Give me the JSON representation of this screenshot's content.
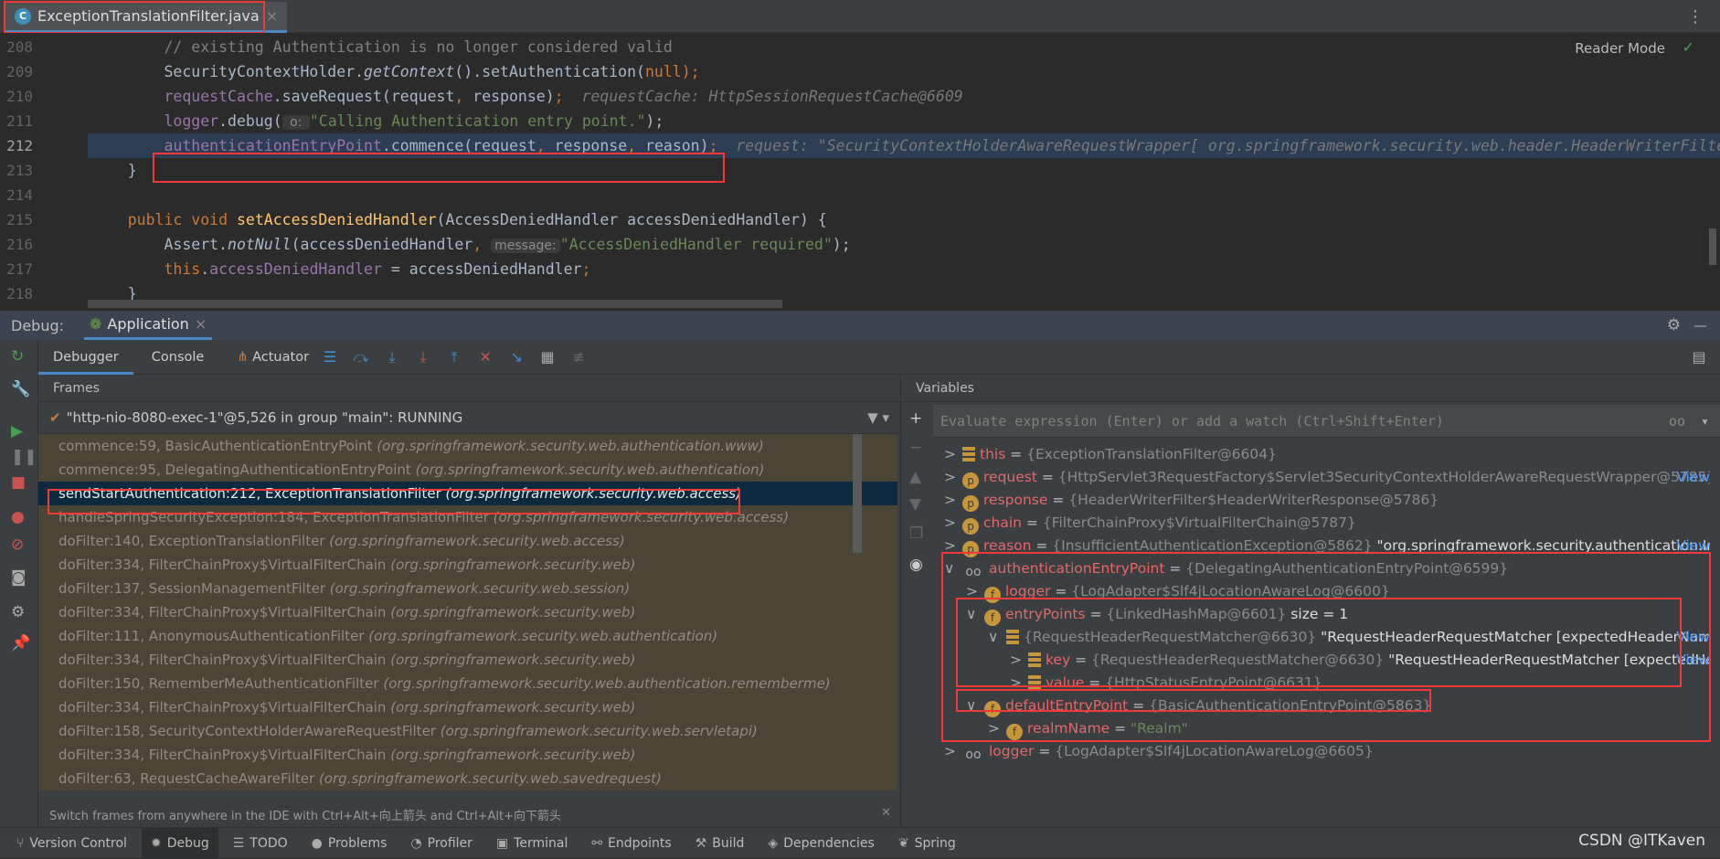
{
  "tab": {
    "file": "ExceptionTranslationFilter.java",
    "close": "×",
    "icon": "java-class-icon"
  },
  "editor": {
    "reader_mode": "Reader Mode",
    "current_line": "212",
    "lines": [
      {
        "n": "208",
        "t": [
          [
            "        // existing Authentication is no longer considered valid",
            "cm"
          ]
        ]
      },
      {
        "n": "209",
        "t": [
          [
            "        SecurityContextHolder.",
            ""
          ],
          [
            "getContext",
            "it"
          ],
          [
            "().setAuthentication(",
            ""
          ],
          [
            "null",
            "kw"
          ],
          [
            ");",
            "kw"
          ]
        ]
      },
      {
        "n": "210",
        "t": [
          [
            "        ",
            ""
          ],
          [
            "requestCache",
            "fld"
          ],
          [
            ".saveRequest(request",
            ""
          ],
          [
            ",",
            "kw"
          ],
          [
            " response)",
            ""
          ],
          [
            ";",
            "kw"
          ],
          [
            "  requestCache: HttpSessionRequestCache@6609",
            "hint"
          ]
        ]
      },
      {
        "n": "211",
        "t": [
          [
            "        ",
            ""
          ],
          [
            "logger",
            "fld"
          ],
          [
            ".debug(",
            ""
          ],
          [
            " o: ",
            "inl"
          ],
          [
            "\"Calling Authentication entry point.\"",
            "str"
          ],
          [
            ");",
            ""
          ]
        ]
      },
      {
        "n": "212",
        "t": [
          [
            "        ",
            ""
          ],
          [
            "authenticationEntryPoint",
            "fld"
          ],
          [
            ".commence(request",
            ""
          ],
          [
            ",",
            "kw"
          ],
          [
            " response",
            ""
          ],
          [
            ",",
            "kw"
          ],
          [
            " reason)",
            ""
          ],
          [
            ";",
            "kw"
          ],
          [
            "  request: \"SecurityContextHolderAwareRequestWrapper[ org.springframework.security.web.header.HeaderWriterFilter",
            "hint"
          ]
        ]
      },
      {
        "n": "213",
        "t": [
          [
            "    }",
            ""
          ]
        ]
      },
      {
        "n": "214",
        "t": [
          [
            "",
            ""
          ]
        ]
      },
      {
        "n": "215",
        "t": [
          [
            "    ",
            ""
          ],
          [
            "public void ",
            "kw"
          ],
          [
            "setAccessDeniedHandler",
            "fn"
          ],
          [
            "(AccessDeniedHandler accessDeniedHandler) {",
            ""
          ]
        ]
      },
      {
        "n": "216",
        "t": [
          [
            "        Assert.",
            ""
          ],
          [
            "notNull",
            "it"
          ],
          [
            "(accessDeniedHandler",
            ""
          ],
          [
            ", ",
            "kw"
          ],
          [
            "message:",
            "inl"
          ],
          [
            "\"AccessDeniedHandler required\"",
            "str"
          ],
          [
            ");",
            ""
          ]
        ]
      },
      {
        "n": "217",
        "t": [
          [
            "        ",
            ""
          ],
          [
            "this",
            "kw"
          ],
          [
            ".",
            ""
          ],
          [
            "accessDeniedHandler",
            "fld"
          ],
          [
            " = accessDeniedHandler",
            ""
          ],
          [
            ";",
            "kw"
          ]
        ]
      },
      {
        "n": "218",
        "t": [
          [
            "    }",
            ""
          ]
        ]
      }
    ]
  },
  "debug": {
    "label": "Debug:",
    "session": "Application",
    "close": "×",
    "tabs": [
      "Debugger",
      "Console",
      "Actuator"
    ],
    "frames_header": "Frames",
    "variables_header": "Variables",
    "thread": "\"http-nio-8080-exec-1\"@5,526 in group \"main\": RUNNING",
    "frames": [
      {
        "m": "commence:59, BasicAuthenticationEntryPoint",
        "p": "(org.springframework.security.web.authentication.www)"
      },
      {
        "m": "commence:95, DelegatingAuthenticationEntryPoint",
        "p": "(org.springframework.security.web.authentication)"
      },
      {
        "m": "sendStartAuthentication:212, ExceptionTranslationFilter",
        "p": "(org.springframework.security.web.access)",
        "selected": true
      },
      {
        "m": "handleSpringSecurityException:184, ExceptionTranslationFilter",
        "p": "(org.springframework.security.web.access)"
      },
      {
        "m": "doFilter:140, ExceptionTranslationFilter",
        "p": "(org.springframework.security.web.access)"
      },
      {
        "m": "doFilter:334, FilterChainProxy$VirtualFilterChain",
        "p": "(org.springframework.security.web)"
      },
      {
        "m": "doFilter:137, SessionManagementFilter",
        "p": "(org.springframework.security.web.session)"
      },
      {
        "m": "doFilter:334, FilterChainProxy$VirtualFilterChain",
        "p": "(org.springframework.security.web)"
      },
      {
        "m": "doFilter:111, AnonymousAuthenticationFilter",
        "p": "(org.springframework.security.web.authentication)"
      },
      {
        "m": "doFilter:334, FilterChainProxy$VirtualFilterChain",
        "p": "(org.springframework.security.web)"
      },
      {
        "m": "doFilter:150, RememberMeAuthenticationFilter",
        "p": "(org.springframework.security.web.authentication.rememberme)"
      },
      {
        "m": "doFilter:334, FilterChainProxy$VirtualFilterChain",
        "p": "(org.springframework.security.web)"
      },
      {
        "m": "doFilter:158, SecurityContextHolderAwareRequestFilter",
        "p": "(org.springframework.security.web.servletapi)"
      },
      {
        "m": "doFilter:334, FilterChainProxy$VirtualFilterChain",
        "p": "(org.springframework.security.web)"
      },
      {
        "m": "doFilter:63, RequestCacheAwareFilter",
        "p": "(org.springframework.security.web.savedrequest)"
      }
    ],
    "frames_hint": "Switch frames from anywhere in the IDE with Ctrl+Alt+向上箭头 and Ctrl+Alt+向下箭头",
    "eval_placeholder": "Evaluate expression (Enter) or add a watch (Ctrl+Shift+Enter)",
    "variables": [
      {
        "d": 0,
        "tw": ">",
        "ic": "bars",
        "n": "this",
        "v": "{ExceptionTranslationFilter@6604}"
      },
      {
        "d": 0,
        "tw": ">",
        "ic": "p",
        "n": "request",
        "v": "{HttpServlet3RequestFactory$Servlet3SecurityContextHolderAwareRequestWrapper@5785}",
        "s": " ...",
        "view": "View"
      },
      {
        "d": 0,
        "tw": ">",
        "ic": "p",
        "n": "response",
        "v": "{HeaderWriterFilter$HeaderWriterResponse@5786}"
      },
      {
        "d": 0,
        "tw": ">",
        "ic": "p",
        "n": "chain",
        "v": "{FilterChainProxy$VirtualFilterChain@5787}"
      },
      {
        "d": 0,
        "tw": ">",
        "ic": "p",
        "n": "reason",
        "v": "{InsufficientAuthenticationException@5862}",
        "s": " \"org.springframework.security.authentication.Ins...",
        "view": "View"
      },
      {
        "d": 0,
        "tw": "∨",
        "ic": "glass",
        "n": "authenticationEntryPoint",
        "v": "{DelegatingAuthenticationEntryPoint@6599}"
      },
      {
        "d": 1,
        "tw": ">",
        "ic": "f",
        "n": "logger",
        "v": "{LogAdapter$Slf4jLocationAwareLog@6600}"
      },
      {
        "d": 1,
        "tw": "∨",
        "ic": "f",
        "n": "entryPoints",
        "v": "{LinkedHashMap@6601}",
        "s": "  size = 1"
      },
      {
        "d": 2,
        "tw": "∨",
        "ic": "bars",
        "n": "",
        "v": "{RequestHeaderRequestMatcher@6630}",
        "s": " \"RequestHeaderRequestMatcher [expectedHeaderName...",
        "view": "View"
      },
      {
        "d": 3,
        "tw": ">",
        "ic": "bars",
        "n": "key",
        "v": "{RequestHeaderRequestMatcher@6630}",
        "s": " \"RequestHeaderRequestMatcher [expectedHe...",
        "view": "View"
      },
      {
        "d": 3,
        "tw": ">",
        "ic": "bars",
        "n": "value",
        "v": "{HttpStatusEntryPoint@6631}"
      },
      {
        "d": 1,
        "tw": "∨",
        "ic": "f",
        "n": "defaultEntryPoint",
        "v": "{BasicAuthenticationEntryPoint@5863}"
      },
      {
        "d": 2,
        "tw": ">",
        "ic": "f",
        "n": "realmName",
        "v": "",
        "str": "\"Realm\""
      },
      {
        "d": 0,
        "tw": ">",
        "ic": "glass",
        "n": "logger",
        "v": "{LogAdapter$Slf4jLocationAwareLog@6605}"
      }
    ]
  },
  "statusbar": [
    {
      "icon": "version-control-icon",
      "label": "Version Control"
    },
    {
      "icon": "debug-icon",
      "label": "Debug",
      "active": true
    },
    {
      "icon": "todo-icon",
      "label": "TODO"
    },
    {
      "icon": "problems-icon",
      "label": "Problems"
    },
    {
      "icon": "profiler-icon",
      "label": "Profiler"
    },
    {
      "icon": "terminal-icon",
      "label": "Terminal"
    },
    {
      "icon": "endpoints-icon",
      "label": "Endpoints"
    },
    {
      "icon": "build-icon",
      "label": "Build"
    },
    {
      "icon": "dependencies-icon",
      "label": "Dependencies"
    },
    {
      "icon": "spring-icon",
      "label": "Spring"
    }
  ],
  "watermark": "CSDN @ITKaven",
  "colors": {
    "highlight": "#f03a3a",
    "selected_frame": "#0d293e",
    "library_frame": "#4a4536",
    "accent": "#4a88c7"
  }
}
